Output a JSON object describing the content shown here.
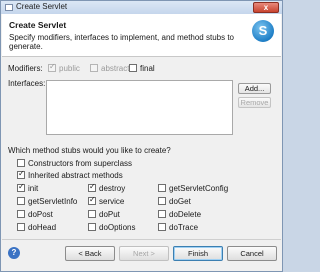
{
  "window": {
    "title": "Create Servlet",
    "close_glyph": "x"
  },
  "banner": {
    "heading": "Create Servlet",
    "description": "Specify modifiers, interfaces to implement, and method stubs to generate.",
    "logo_glyph": "S"
  },
  "modifiers": {
    "label": "Modifiers:",
    "public_label": "public",
    "abstract_label": "abstract",
    "final_label": "final"
  },
  "interfaces": {
    "label": "Interfaces:",
    "add_button": "Add...",
    "remove_button": "Remove"
  },
  "stubs": {
    "question": "Which method stubs would you like to create?",
    "constructors_label": "Constructors from superclass",
    "inherited_label": "Inherited abstract methods",
    "methods": [
      "init",
      "destroy",
      "getServletConfig",
      "getServletInfo",
      "service",
      "doGet",
      "doPost",
      "doPut",
      "doDelete",
      "doHead",
      "doOptions",
      "doTrace"
    ]
  },
  "footer": {
    "help_glyph": "?",
    "back_button": "< Back",
    "next_button": "Next >",
    "finish_button": "Finish",
    "cancel_button": "Cancel"
  }
}
